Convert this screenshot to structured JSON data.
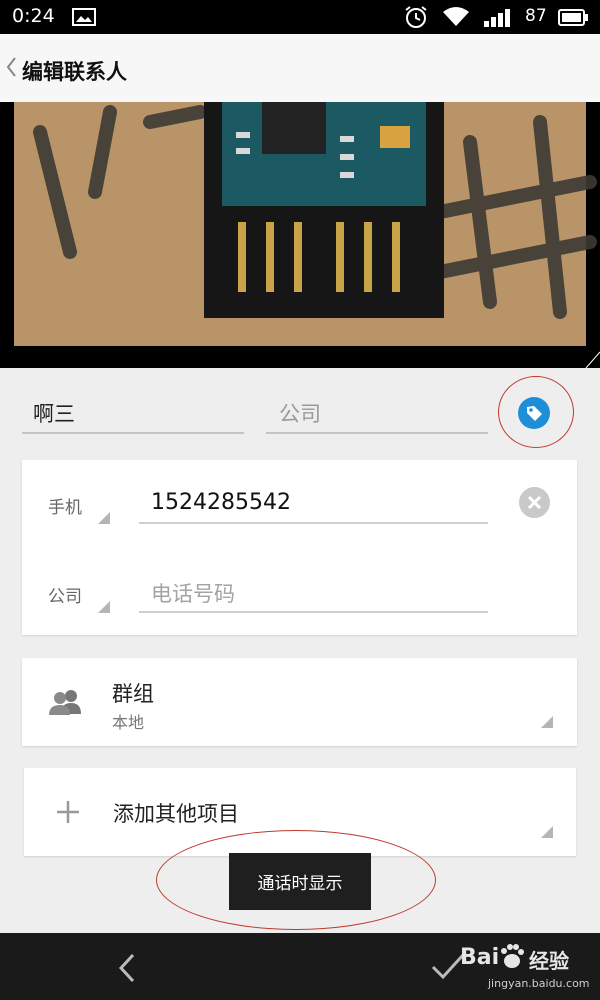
{
  "status_bar": {
    "time": "0:24",
    "battery_level": "87",
    "icons": [
      "image-icon",
      "alarm-icon",
      "wifi-icon",
      "signal-icon",
      "battery-icon"
    ]
  },
  "app_bar": {
    "title": "编辑联系人",
    "back_icon": "chevron-left-icon"
  },
  "contact": {
    "name_value": "啊三",
    "company_placeholder": "公司",
    "tag_icon": "tag-icon"
  },
  "phones": [
    {
      "type": "手机",
      "value": "1524285542"
    },
    {
      "type": "公司",
      "placeholder": "电话号码"
    }
  ],
  "group": {
    "title": "群组",
    "subtitle": "本地",
    "icon": "people-icon"
  },
  "add_field": {
    "label": "添加其他项目",
    "icon": "plus-icon"
  },
  "toast": {
    "text": "通话时显示"
  },
  "bottom_bar": {
    "back_icon": "back-icon",
    "confirm_icon": "check-icon"
  },
  "watermark": {
    "brand": "Bai",
    "cn": "经验",
    "url": "jingyan.baidu.com"
  },
  "colors": {
    "accent": "#1e8fd6",
    "annotation": "#c0392b",
    "status_bar": "#000000",
    "nav_bar": "#1a1a1a"
  }
}
